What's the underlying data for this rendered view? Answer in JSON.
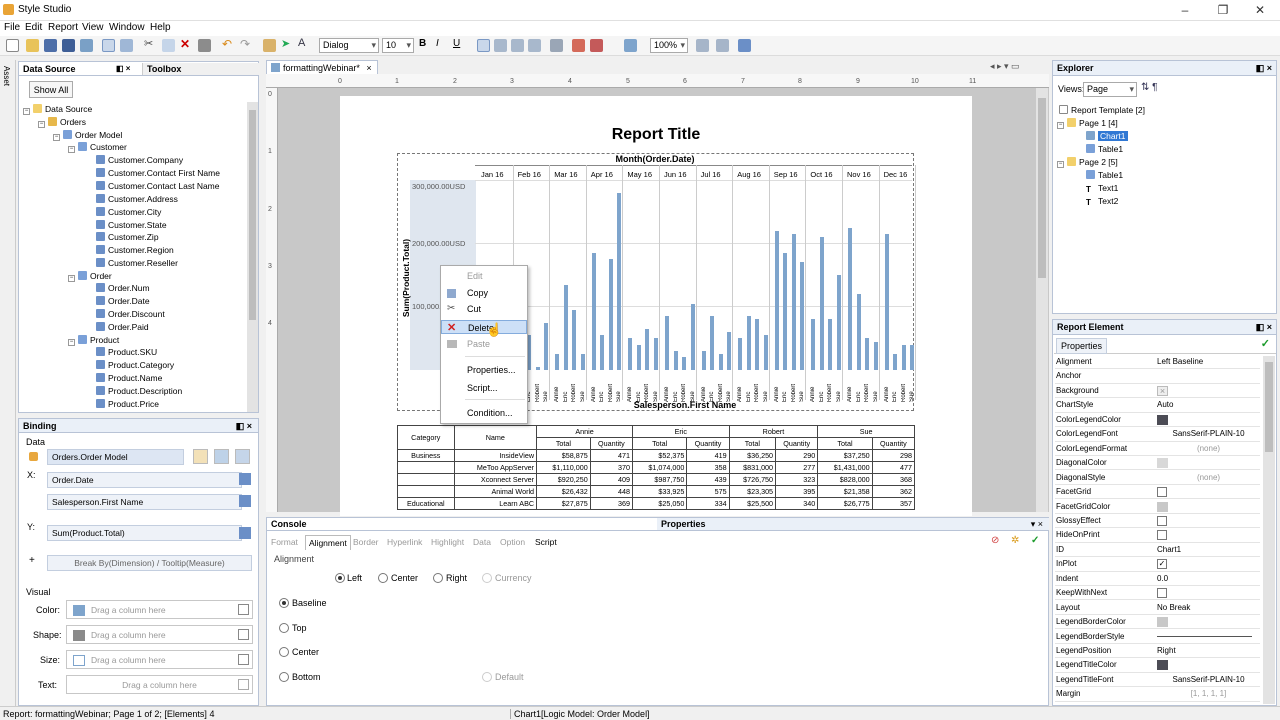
{
  "app": {
    "title": "Style Studio",
    "menu": [
      "File",
      "Edit",
      "Report",
      "View",
      "Window",
      "Help"
    ]
  },
  "toolbar": {
    "font": "Dialog",
    "size": "10",
    "zoom": "100%"
  },
  "datasource": {
    "title": "Data Source",
    "toolbox": "Toolbox",
    "show_all": "Show All",
    "side_tab": "Asset",
    "tree": [
      "Data Source",
      "Orders",
      "Order Model",
      "Customer",
      "Customer.Company",
      "Customer.Contact First Name",
      "Customer.Contact Last Name",
      "Customer.Address",
      "Customer.City",
      "Customer.State",
      "Customer.Zip",
      "Customer.Region",
      "Customer.Reseller",
      "Order",
      "Order.Num",
      "Order.Date",
      "Order.Discount",
      "Order.Paid",
      "Product",
      "Product.SKU",
      "Product.Category",
      "Product.Name",
      "Product.Description",
      "Product.Price"
    ]
  },
  "binding": {
    "title": "Binding",
    "data": "Data",
    "model": "Orders.Order Model",
    "x_label": "X:",
    "y_label": "Y:",
    "x1": "Order.Date",
    "x2": "Salesperson.First Name",
    "y1": "Sum(Product.Total)",
    "plus": "+",
    "breakby": "Break By(Dimension) / Tooltip(Measure)",
    "visual": "Visual",
    "color": "Color:",
    "shape": "Shape:",
    "size": "Size:",
    "text": "Text:",
    "drag": "Drag a column here"
  },
  "editor": {
    "tab": "formattingWebinar*",
    "report_title": "Report Title",
    "ruler": [
      "0",
      "1",
      "2",
      "3",
      "4",
      "5",
      "6",
      "7",
      "8",
      "9",
      "10",
      "11"
    ],
    "vruler": [
      "0",
      "1",
      "2",
      "3",
      "4"
    ]
  },
  "chart_data": {
    "type": "bar",
    "title": "Month(Order.Date)",
    "xlabel": "Salesperson.First Name",
    "ylabel": "Sum(Product.Total)",
    "yticks": [
      "300,000.00USD",
      "200,000.00USD",
      "100,000.00USD"
    ],
    "ylim": [
      0,
      300000
    ],
    "months": [
      "Jan 16",
      "Feb 16",
      "Mar 16",
      "Apr 16",
      "May 16",
      "Jun 16",
      "Jul 16",
      "Aug 16",
      "Sep 16",
      "Oct 16",
      "Nov 16",
      "Dec 16"
    ],
    "salespeople": [
      "Annie",
      "Eric",
      "Robert",
      "Sue"
    ],
    "values": [
      [
        60000,
        25000,
        70000,
        105000
      ],
      [
        80000,
        55000,
        5000,
        75000
      ],
      [
        25000,
        135000,
        95000,
        25000
      ],
      [
        185000,
        55000,
        175000,
        280000
      ],
      [
        50000,
        40000,
        65000,
        50000
      ],
      [
        85000,
        30000,
        20000,
        105000
      ],
      [
        30000,
        85000,
        25000,
        60000
      ],
      [
        50000,
        85000,
        80000,
        55000
      ],
      [
        220000,
        185000,
        215000,
        170000
      ],
      [
        80000,
        210000,
        80000,
        150000
      ],
      [
        225000,
        120000,
        50000,
        45000
      ],
      [
        215000,
        25000,
        40000,
        40000
      ]
    ]
  },
  "table": {
    "headers": [
      "Category",
      "Name",
      "Annie",
      "Eric",
      "Robert",
      "Sue"
    ],
    "sub": [
      "Total",
      "Quantity"
    ],
    "rows": [
      [
        "Business",
        "InsideView",
        "$58,875",
        "471",
        "$52,375",
        "419",
        "$36,250",
        "290",
        "$37,250",
        "298"
      ],
      [
        "",
        "MeToo AppServer",
        "$1,110,000",
        "370",
        "$1,074,000",
        "358",
        "$831,000",
        "277",
        "$1,431,000",
        "477"
      ],
      [
        "",
        "Xconnect Server",
        "$920,250",
        "409",
        "$987,750",
        "439",
        "$726,750",
        "323",
        "$828,000",
        "368"
      ],
      [
        "",
        "Animal World",
        "$26,432",
        "448",
        "$33,925",
        "575",
        "$23,305",
        "395",
        "$21,358",
        "362"
      ],
      [
        "Educational",
        "Learn ABC",
        "$27,875",
        "369",
        "$25,050",
        "334",
        "$25,500",
        "340",
        "$26,775",
        "357"
      ]
    ]
  },
  "context_menu": [
    "Edit",
    "Copy",
    "Cut",
    "Delete",
    "Paste",
    "Properties...",
    "Script...",
    "Condition..."
  ],
  "console": {
    "title": "Console",
    "properties": "Properties",
    "tabs": [
      "Format",
      "Alignment",
      "Border",
      "Hyperlink",
      "Highlight",
      "Data",
      "Option",
      "Script"
    ],
    "alignment": "Alignment",
    "h": [
      "Left",
      "Center",
      "Right",
      "Currency"
    ],
    "v": [
      "Baseline",
      "Top",
      "Center",
      "Bottom"
    ],
    "default": "Default"
  },
  "explorer": {
    "title": "Explorer",
    "views": "Views:",
    "view_value": "Page",
    "items": [
      "Report Template [2]",
      "Page 1 [4]",
      "Chart1",
      "Table1",
      "Page 2 [5]",
      "Table1",
      "Text1",
      "Text2"
    ]
  },
  "report_element": {
    "title": "Report Element",
    "tab": "Properties",
    "props": [
      [
        "Alignment",
        "Left Baseline"
      ],
      [
        "Anchor",
        ""
      ],
      [
        "Background",
        "x"
      ],
      [
        "ChartStyle",
        "Auto"
      ],
      [
        "ColorLegendColor",
        "sw:#4c4c55"
      ],
      [
        "ColorLegendFont",
        "SansSerif-PLAIN-10"
      ],
      [
        "ColorLegendFormat",
        "(none)"
      ],
      [
        "DiagonalColor",
        "sw:#d8d8d8"
      ],
      [
        "DiagonalStyle",
        "(none)"
      ],
      [
        "FacetGrid",
        "chk"
      ],
      [
        "FacetGridColor",
        "sw:#c8c8c8"
      ],
      [
        "GlossyEffect",
        "chk"
      ],
      [
        "HideOnPrint",
        "chk"
      ],
      [
        "ID",
        "Chart1"
      ],
      [
        "InPlot",
        "chk-on"
      ],
      [
        "Indent",
        "0.0"
      ],
      [
        "KeepWithNext",
        "chk"
      ],
      [
        "Layout",
        "No Break"
      ],
      [
        "LegendBorderColor",
        "sw:#c8c8c8"
      ],
      [
        "LegendBorderStyle",
        "line"
      ],
      [
        "LegendPosition",
        "Right"
      ],
      [
        "LegendTitleColor",
        "sw:#4c4c55"
      ],
      [
        "LegendTitleFont",
        "SansSerif-PLAIN-10"
      ],
      [
        "Margin",
        "[1, 1, 1, 1]"
      ]
    ]
  },
  "status": {
    "left": "Report: formattingWebinar; Page 1 of 2; [Elements] 4",
    "mid": "Chart1[Logic Model: Order Model]"
  }
}
